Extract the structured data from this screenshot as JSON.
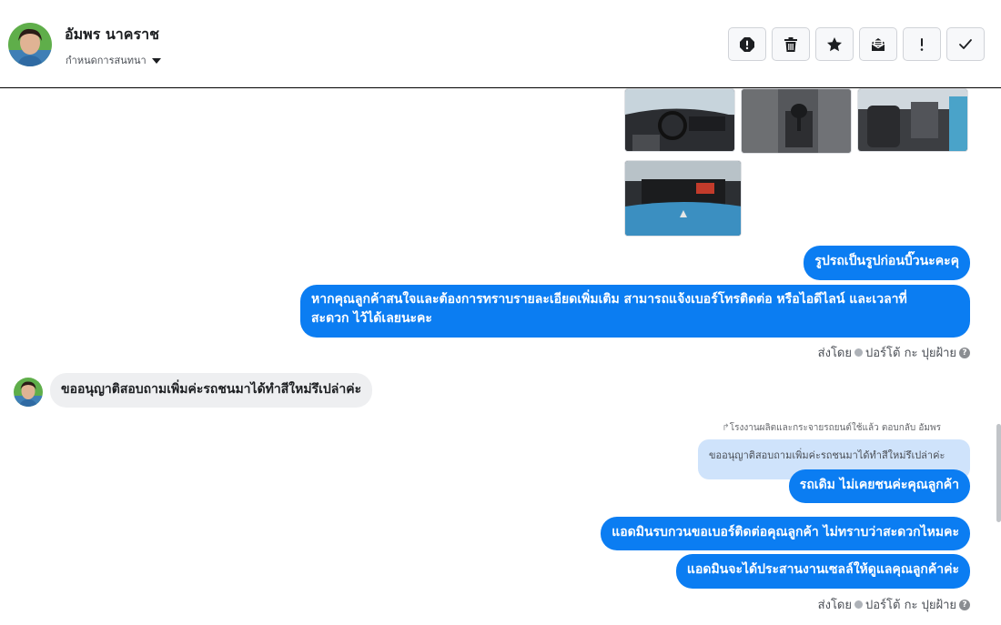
{
  "header": {
    "contact_name": "อัมพร นาคราช",
    "assign_label": "กำหนดการสนทนา",
    "toolbar": [
      {
        "name": "report-icon",
        "label": "report"
      },
      {
        "name": "trash-icon",
        "label": "delete"
      },
      {
        "name": "star-icon",
        "label": "star"
      },
      {
        "name": "mark-unread-icon",
        "label": "mark unread"
      },
      {
        "name": "exclamation-icon",
        "label": "!"
      },
      {
        "name": "checkmark-icon",
        "label": "done"
      }
    ]
  },
  "messages": {
    "out_1": "รูปรถเป็นรูปก่อนบิ๊วนะคะคุ",
    "out_2_line1": "หากคุณลูกค้าสนใจและต้องการทราบรายละเอียดเพิ่มเติม สามารถแจ้งเบอร์โทรติดต่อ หรือไอดีไลน์ และเวลาที่",
    "out_2_line2": "สะดวก ไว้ได้เลยนะคะ",
    "sent_by_1": {
      "prefix": "ส่งโดย",
      "agent": "ปอร์โต้ กะ ปุยฝ้าย"
    },
    "in_1": "ขออนุญาติสอบถามเพิ่มค่ะรถชนมาได้ทำสีใหม่รึเปล่าค่ะ",
    "reply_label": "โรงงานผลิตและกระจายรถยนต์ใช้แล้ว ตอบกลับ อัมพร",
    "quoted_text": "ขออนุญาติสอบถามเพิ่มค่ะรถชนมาได้ทำสีใหม่รึเปล่าค่ะ",
    "out_3": "รถเดิม ไม่เคยชนค่ะคุณลูกค้า",
    "out_4": "แอดมินรบกวนขอเบอร์ติดต่อคุณลูกค้า ไม่ทราบว่าสะดวกไหมคะ",
    "out_5": "แอดมินจะได้ประสานงานเซลล์ให้ดูแลคุณลูกค้าค่ะ",
    "sent_by_2": {
      "prefix": "ส่งโดย",
      "agent": "ปอร์โต้ กะ ปุยฝ้าย"
    }
  },
  "colors": {
    "outgoing_bubble": "#0b7df2",
    "incoming_bubble": "#eeeff1",
    "quoted_bg": "#cfe3fb"
  }
}
